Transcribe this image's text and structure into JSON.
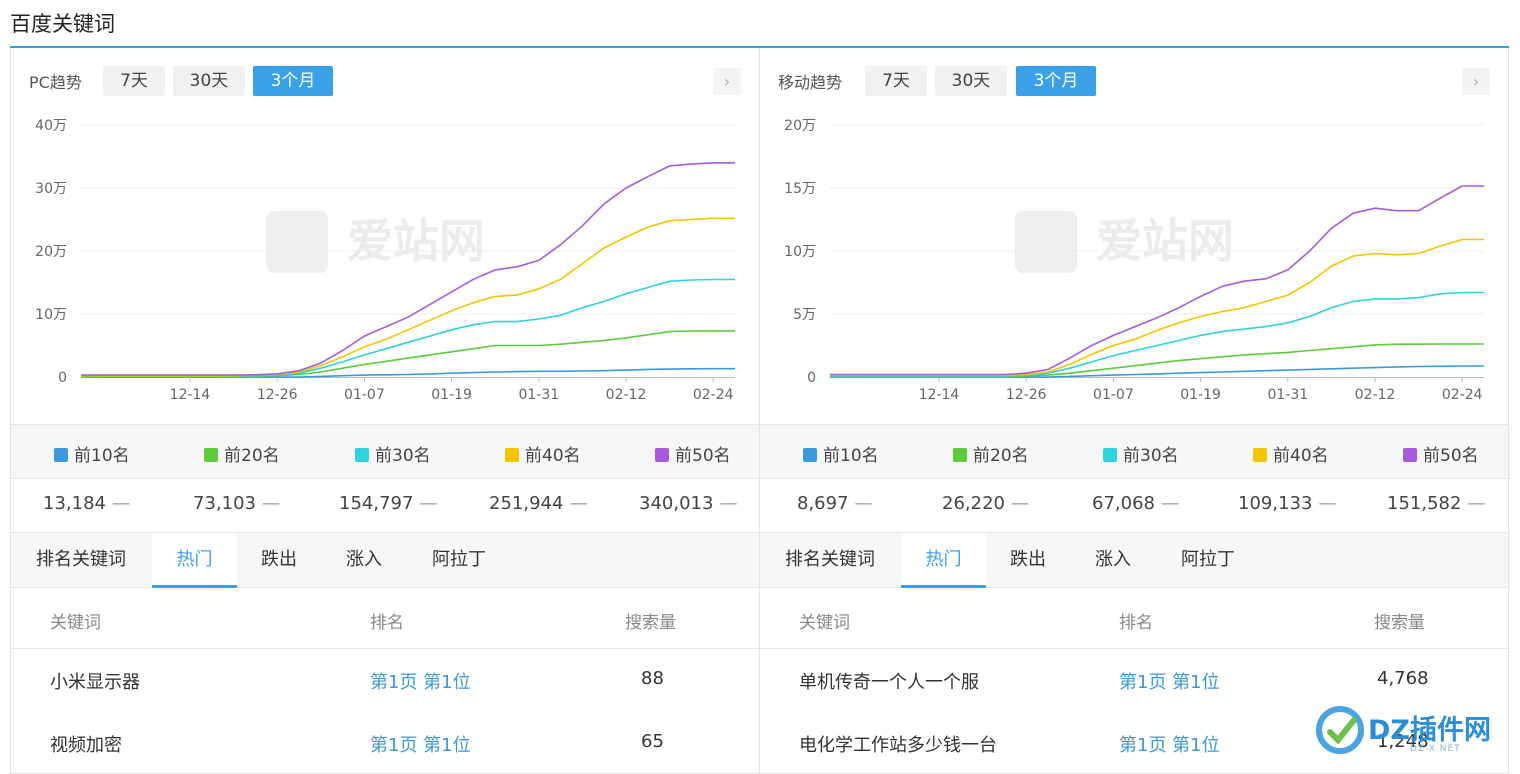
{
  "page_title": "百度关键词",
  "icons": {
    "next": "chevron-right-icon",
    "logo": "dz-logo-icon"
  },
  "colors": {
    "accent": "#3aa1e6",
    "top10": "#3b99dc",
    "top20": "#5ccc3a",
    "top30": "#2ed3dd",
    "top40": "#f5c400",
    "top50": "#a85bdc"
  },
  "range_labels": [
    "7天",
    "30天",
    "3个月"
  ],
  "active_range": "3个月",
  "tabs": [
    "排名关键词",
    "热门",
    "跌出",
    "涨入",
    "阿拉丁"
  ],
  "active_tab": "热门",
  "watermark": "爱站网",
  "panels": [
    {
      "label": "PC趋势",
      "legend": [
        "前10名",
        "前20名",
        "前30名",
        "前40名",
        "前50名"
      ],
      "values": [
        "13,184",
        "73,103",
        "154,797",
        "251,944",
        "340,013"
      ],
      "trend_mark": "—",
      "table": {
        "headers": [
          "关键词",
          "排名",
          "搜索量"
        ],
        "rows": [
          {
            "keyword": "小米显示器",
            "rank": "第1页 第1位",
            "volume": "88"
          },
          {
            "keyword": "视频加密",
            "rank": "第1页 第1位",
            "volume": "65"
          }
        ]
      }
    },
    {
      "label": "移动趋势",
      "legend": [
        "前10名",
        "前20名",
        "前30名",
        "前40名",
        "前50名"
      ],
      "values": [
        "8,697",
        "26,220",
        "67,068",
        "109,133",
        "151,582"
      ],
      "trend_mark": "—",
      "table": {
        "headers": [
          "关键词",
          "排名",
          "搜索量"
        ],
        "rows": [
          {
            "keyword": "单机传奇一个人一个服",
            "rank": "第1页 第1位",
            "volume": "4,768"
          },
          {
            "keyword": "电化学工作站多少钱一台",
            "rank": "第1页 第1位",
            "volume": "1,248"
          }
        ]
      }
    }
  ],
  "logo": {
    "text": "DZ插件网",
    "sub": "DZ-X.NET"
  },
  "chart_data": [
    {
      "type": "line",
      "title": "PC趋势",
      "x": [
        "11-29",
        "12-02",
        "12-05",
        "12-08",
        "12-11",
        "12-14",
        "12-17",
        "12-20",
        "12-23",
        "12-26",
        "12-29",
        "01-01",
        "01-04",
        "01-07",
        "01-10",
        "01-13",
        "01-16",
        "01-19",
        "01-22",
        "01-25",
        "01-28",
        "01-31",
        "02-03",
        "02-06",
        "02-09",
        "02-12",
        "02-15",
        "02-18",
        "02-21",
        "02-24",
        "02-27"
      ],
      "x_ticks": [
        "12-14",
        "12-26",
        "01-07",
        "01-19",
        "01-31",
        "02-12",
        "02-24"
      ],
      "y_ticks": [
        "0",
        "10万",
        "20万",
        "30万",
        "40万"
      ],
      "ylim": [
        0,
        400000
      ],
      "grid": true,
      "legend_position": "bottom",
      "series": [
        {
          "name": "前10名",
          "values": [
            0,
            0,
            0,
            0,
            0,
            0,
            0,
            0,
            0,
            0,
            0,
            1000,
            2000,
            3000,
            3500,
            4000,
            5000,
            6000,
            7000,
            8000,
            8500,
            9000,
            9000,
            9500,
            10000,
            11000,
            12000,
            12500,
            13000,
            13184,
            13184
          ]
        },
        {
          "name": "前20名",
          "values": [
            1000,
            1000,
            1000,
            1000,
            1000,
            1000,
            1000,
            1000,
            1000,
            2000,
            4000,
            8000,
            14000,
            20000,
            25000,
            30000,
            35000,
            40000,
            45000,
            50000,
            50000,
            50000,
            52000,
            55000,
            58000,
            62000,
            67000,
            72000,
            73000,
            73103,
            73103
          ]
        },
        {
          "name": "前30名",
          "values": [
            2000,
            2000,
            2000,
            2000,
            2000,
            2000,
            2000,
            2000,
            2000,
            3000,
            6000,
            14000,
            24000,
            35000,
            45000,
            55000,
            65000,
            75000,
            83000,
            88000,
            88000,
            92000,
            98000,
            110000,
            120000,
            132000,
            142000,
            152000,
            154000,
            154797,
            154797
          ]
        },
        {
          "name": "前40名",
          "values": [
            2000,
            2000,
            2000,
            2000,
            2000,
            2000,
            2000,
            2000,
            3000,
            4000,
            8000,
            18000,
            32000,
            48000,
            60000,
            75000,
            90000,
            105000,
            118000,
            128000,
            130000,
            140000,
            155000,
            180000,
            205000,
            222000,
            238000,
            248000,
            250000,
            251944,
            251944
          ]
        },
        {
          "name": "前50名",
          "values": [
            3000,
            3000,
            3000,
            3000,
            3000,
            3000,
            3000,
            3000,
            3500,
            5000,
            10000,
            22000,
            42000,
            65000,
            80000,
            95000,
            115000,
            135000,
            155000,
            170000,
            175000,
            185000,
            210000,
            240000,
            275000,
            300000,
            318000,
            335000,
            338000,
            340013,
            340013
          ]
        }
      ]
    },
    {
      "type": "line",
      "title": "移动趋势",
      "x": [
        "11-29",
        "12-02",
        "12-05",
        "12-08",
        "12-11",
        "12-14",
        "12-17",
        "12-20",
        "12-23",
        "12-26",
        "12-29",
        "01-01",
        "01-04",
        "01-07",
        "01-10",
        "01-13",
        "01-16",
        "01-19",
        "01-22",
        "01-25",
        "01-28",
        "01-31",
        "02-03",
        "02-06",
        "02-09",
        "02-12",
        "02-15",
        "02-18",
        "02-21",
        "02-24",
        "02-27"
      ],
      "x_ticks": [
        "12-14",
        "12-26",
        "01-07",
        "01-19",
        "01-31",
        "02-12",
        "02-24"
      ],
      "y_ticks": [
        "0",
        "5万",
        "10万",
        "15万",
        "20万"
      ],
      "ylim": [
        0,
        200000
      ],
      "grid": true,
      "legend_position": "bottom",
      "series": [
        {
          "name": "前10名",
          "values": [
            0,
            0,
            0,
            0,
            0,
            0,
            0,
            0,
            0,
            0,
            0,
            500,
            1000,
            1500,
            2000,
            2500,
            3000,
            3500,
            4000,
            4500,
            5000,
            5500,
            6000,
            6500,
            7000,
            7500,
            8000,
            8300,
            8500,
            8697,
            8697
          ]
        },
        {
          "name": "前20名",
          "values": [
            500,
            500,
            500,
            500,
            500,
            500,
            500,
            500,
            500,
            800,
            1500,
            3000,
            5000,
            7000,
            9000,
            11000,
            13000,
            14500,
            16000,
            17500,
            18500,
            19500,
            21000,
            22500,
            24000,
            25500,
            26000,
            26000,
            26200,
            26220,
            26220
          ]
        },
        {
          "name": "前30名",
          "values": [
            1000,
            1000,
            1000,
            1000,
            1000,
            1000,
            1000,
            1000,
            1000,
            1500,
            3000,
            7000,
            12000,
            17000,
            21000,
            25000,
            29000,
            33000,
            36000,
            38000,
            40000,
            43000,
            48000,
            55000,
            60000,
            62000,
            62000,
            63000,
            66000,
            67068,
            67068
          ]
        },
        {
          "name": "前40名",
          "values": [
            1500,
            1500,
            1500,
            1500,
            1500,
            1500,
            1500,
            1500,
            1500,
            2000,
            4000,
            10000,
            18000,
            25000,
            30000,
            37000,
            43000,
            48000,
            52000,
            55000,
            60000,
            65000,
            75000,
            88000,
            96000,
            98000,
            97000,
            98000,
            104000,
            109133,
            109133
          ]
        },
        {
          "name": "前50名",
          "values": [
            2000,
            2000,
            2000,
            2000,
            2000,
            2000,
            2000,
            2000,
            2000,
            3000,
            6000,
            15000,
            25000,
            33000,
            40000,
            47000,
            55000,
            64000,
            72000,
            76000,
            78000,
            85000,
            100000,
            118000,
            130000,
            134000,
            132000,
            132000,
            142000,
            151582,
            151582
          ]
        }
      ]
    }
  ]
}
